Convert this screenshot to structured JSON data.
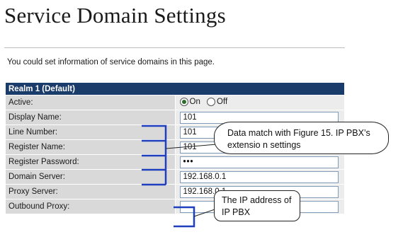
{
  "page": {
    "title": "Service Domain Settings",
    "intro": "You could set information of service domains in this page."
  },
  "realm": {
    "header": "Realm 1 (Default)",
    "rows": [
      {
        "label": "Active:"
      },
      {
        "label": "Display Name:",
        "value": "101"
      },
      {
        "label": "Line Number:",
        "value": "101"
      },
      {
        "label": "Register Name:",
        "value": "101"
      },
      {
        "label": "Register Password:",
        "value": "•••"
      },
      {
        "label": "Domain Server:",
        "value": "192.168.0.1"
      },
      {
        "label": "Proxy Server:",
        "value": "192.168.0.1"
      },
      {
        "label": "Outbound Proxy:",
        "value": ""
      }
    ],
    "active": {
      "on_label": "On",
      "off_label": "Off",
      "selected": "On"
    }
  },
  "callouts": {
    "extension_match": "Data match with Figure 15. IP PBX’s extensio n settings",
    "ip_address": "The IP address of IP PBX"
  },
  "colors": {
    "header_bg": "#1a3c6b",
    "label_bg": "#d9d9d9",
    "value_bg": "#ececec",
    "bracket_line": "#1f3fbf"
  }
}
